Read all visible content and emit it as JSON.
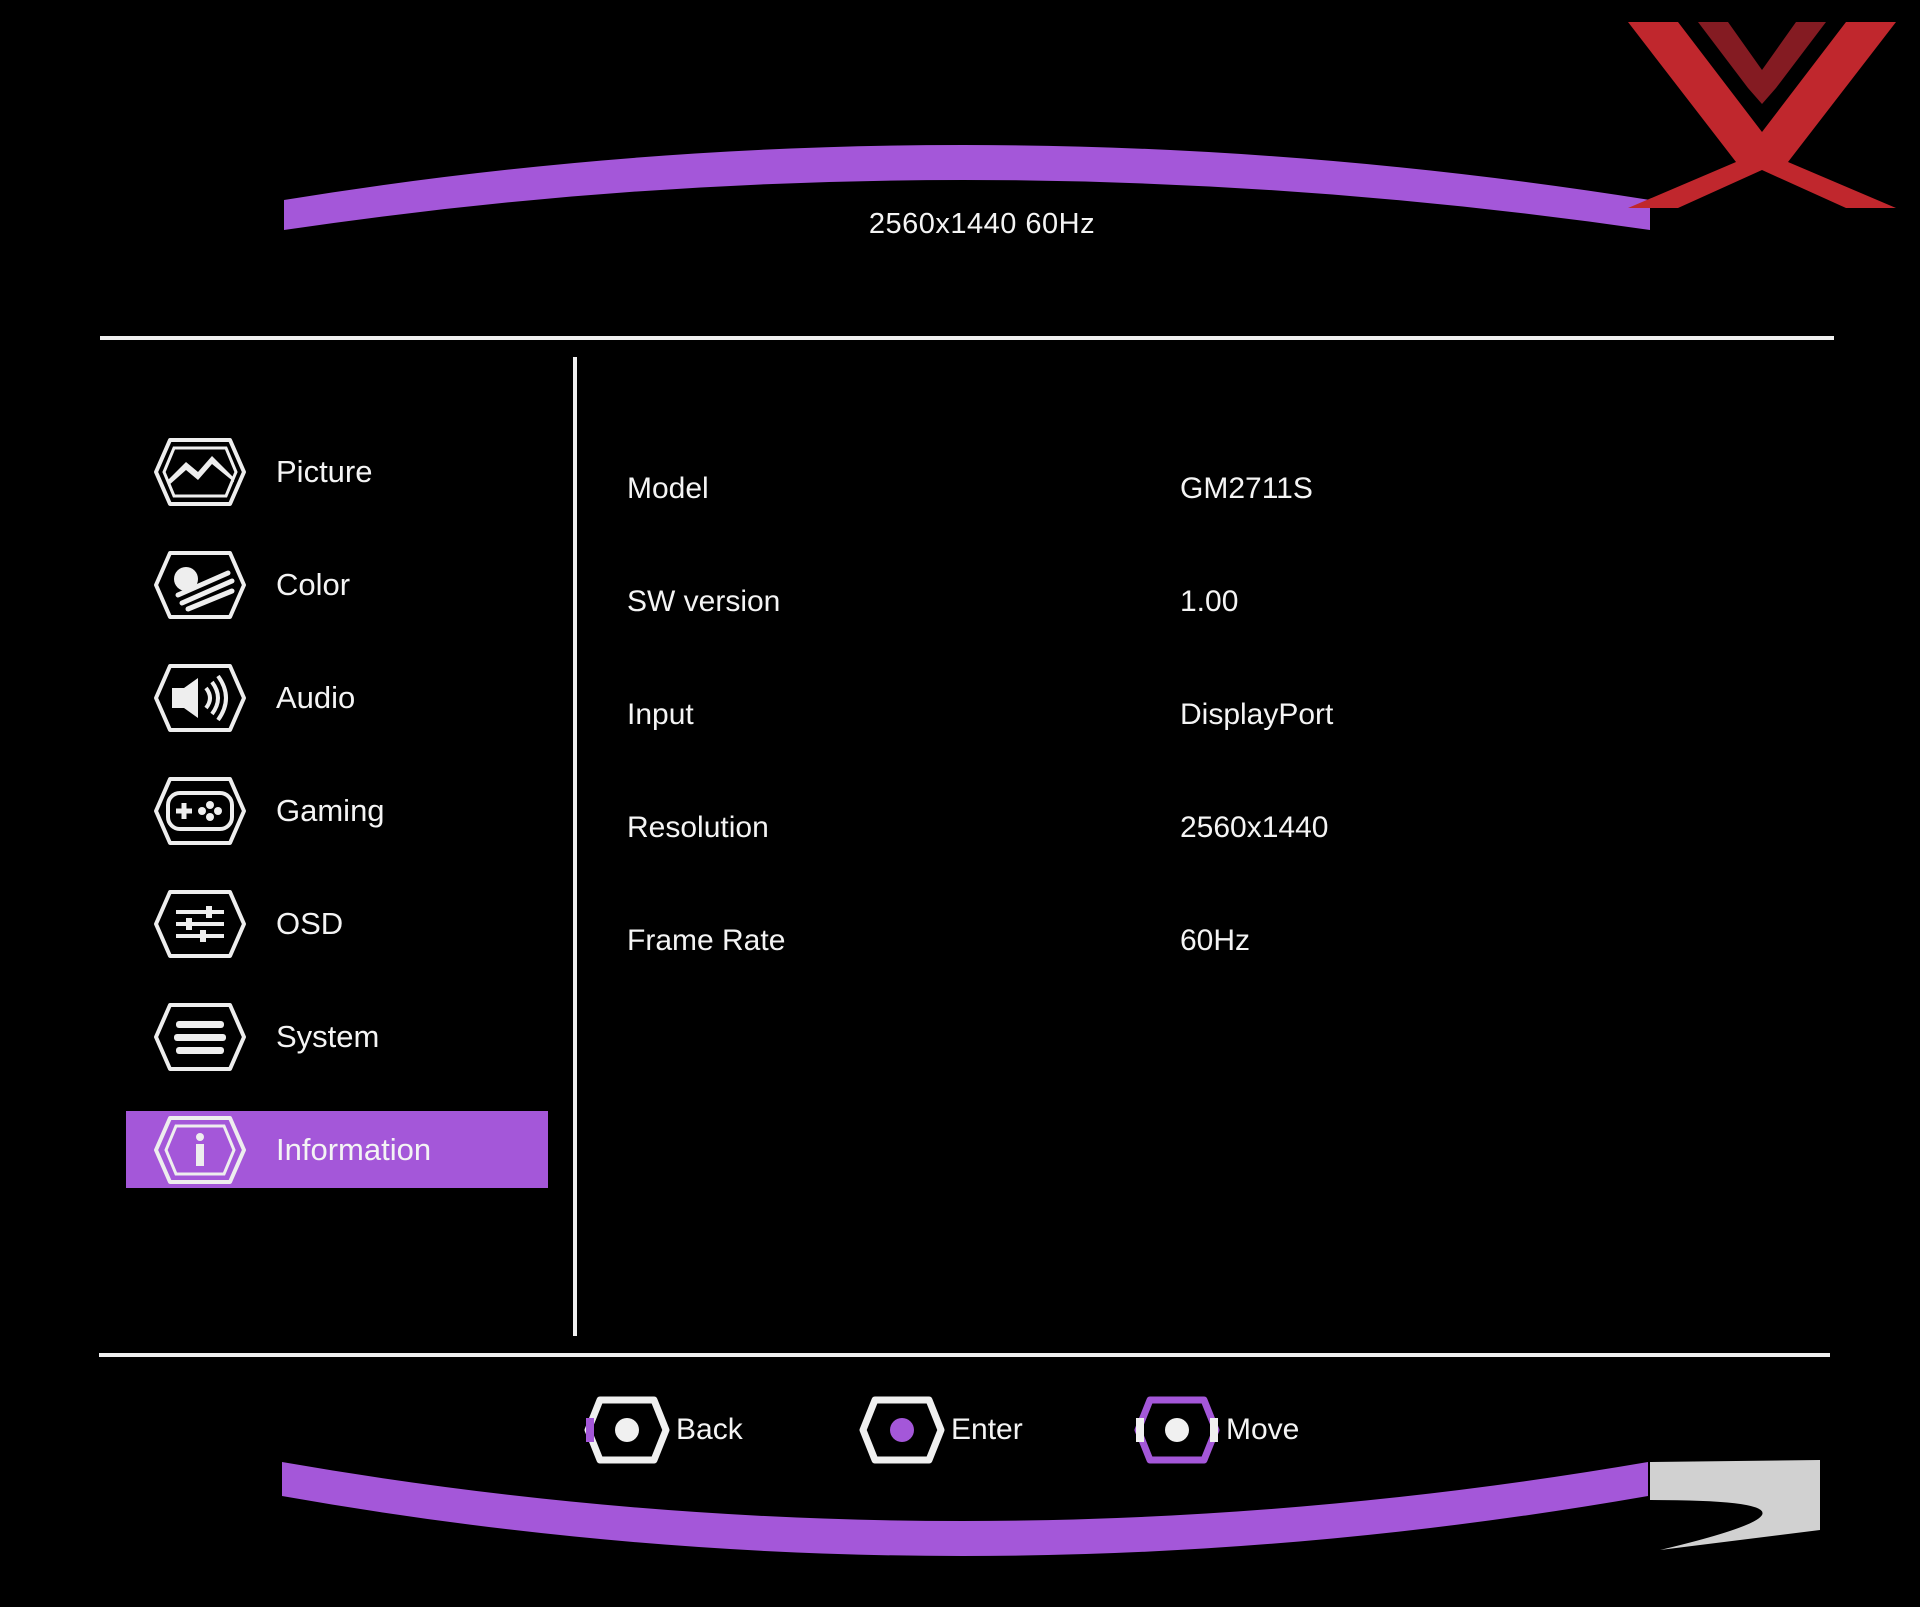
{
  "header": {
    "title": "2560x1440 60Hz"
  },
  "sidebar": {
    "items": [
      {
        "label": "Picture",
        "icon": "picture-icon",
        "selected": false
      },
      {
        "label": "Color",
        "icon": "color-icon",
        "selected": false
      },
      {
        "label": "Audio",
        "icon": "audio-icon",
        "selected": false
      },
      {
        "label": "Gaming",
        "icon": "gaming-icon",
        "selected": false
      },
      {
        "label": "OSD",
        "icon": "osd-sliders-icon",
        "selected": false
      },
      {
        "label": "System",
        "icon": "system-menu-icon",
        "selected": false
      },
      {
        "label": "Information",
        "icon": "info-icon",
        "selected": true
      }
    ]
  },
  "info": {
    "rows": [
      {
        "label": "Model",
        "value": "GM2711S"
      },
      {
        "label": "SW version",
        "value": "1.00"
      },
      {
        "label": "Input",
        "value": "DisplayPort"
      },
      {
        "label": "Resolution",
        "value": "2560x1440"
      },
      {
        "label": "Frame Rate",
        "value": "60Hz"
      }
    ]
  },
  "footer": {
    "hints": [
      {
        "label": "Back",
        "icon": "back-button-icon"
      },
      {
        "label": "Enter",
        "icon": "enter-button-icon"
      },
      {
        "label": "Move",
        "icon": "move-button-icon"
      }
    ]
  },
  "colors": {
    "accent": "#a457d9",
    "background": "#000000",
    "text": "#f4f4f4",
    "logo_red": "#c0272d"
  }
}
